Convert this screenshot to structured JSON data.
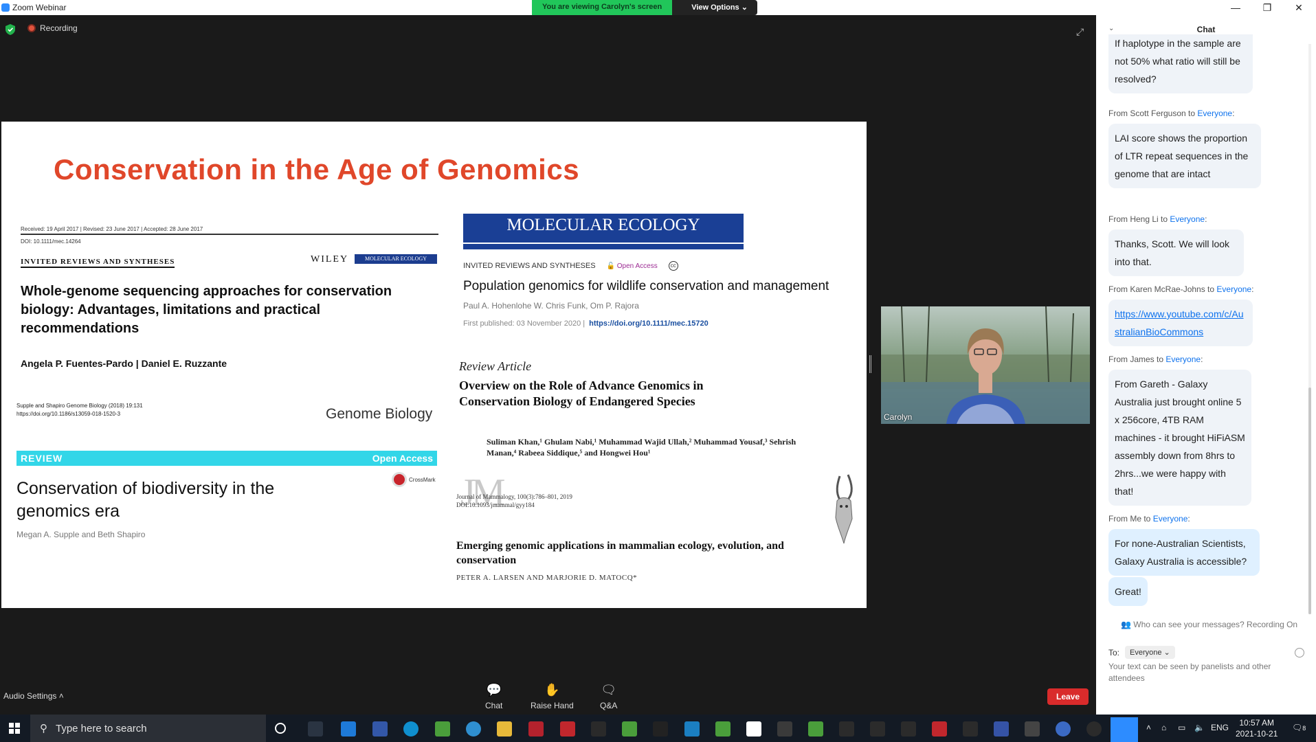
{
  "window": {
    "title": "Zoom Webinar",
    "viewing_message": "You are viewing Carolyn's screen",
    "view_options_label": "View Options"
  },
  "meeting": {
    "recording_label": "Recording",
    "speaker_name": "Carolyn",
    "audio_settings_label": "Audio Settings",
    "controls": [
      {
        "label": "Chat",
        "icon": "chat-icon"
      },
      {
        "label": "Raise Hand",
        "icon": "raise-hand-icon"
      },
      {
        "label": "Q&A",
        "icon": "qa-icon"
      }
    ],
    "leave_label": "Leave"
  },
  "slide": {
    "title": "Conservation in the Age of Genomics",
    "paper1": {
      "meta": "Received: 19 April 2017     |     Revised: 23 June 2017     |     Accepted: 28 June 2017",
      "doi": "DOI: 10.1111/mec.14264",
      "section": "INVITED REVIEWS AND SYNTHESES",
      "publisher": "WILEY",
      "journal_badge": "MOLECULAR ECOLOGY",
      "title": "Whole-genome sequencing approaches for conservation biology: Advantages, limitations and practical recommendations",
      "authors": "Angela P. Fuentes-Pardo   |   Daniel E. Ruzzante"
    },
    "paper2": {
      "cite_line1": "Supple and Shapiro Genome Biology  (2018) 19:131",
      "cite_line2": "https://doi.org/10.1186/s13059-018-1520-3",
      "journal": "Genome Biology",
      "review_label": "REVIEW",
      "open_access_label": "Open Access",
      "crossmark_label": "CrossMark",
      "title": "Conservation of biodiversity in the genomics era",
      "authors": "Megan A. Supple  and Beth Shapiro"
    },
    "paper3": {
      "journal_banner": "MOLECULAR ECOLOGY",
      "section": "INVITED REVIEWS AND SYNTHESES",
      "open_access_label": "Open Access",
      "title": "Population genomics for wildlife conservation and management",
      "authors": "Paul A. Hohenlohe   W. Chris Funk, Om P. Rajora",
      "published": "First published: 03 November 2020  |",
      "doi": "https://doi.org/10.1111/mec.15720"
    },
    "paper4": {
      "kind": "Review Article",
      "title": "Overview on the Role of Advance Genomics in Conservation Biology of Endangered Species",
      "authors": "Suliman Khan,¹ Ghulam Nabi,¹ Muhammad Wajid Ullah,² Muhammad Yousaf,³ Sehrish Manan,⁴ Rabeea Siddique,⁵ and Hongwei Hou¹"
    },
    "paper5": {
      "logo_text": "JM",
      "cite_line1": "Journal of Mammalogy, 100(3):786–801, 2019",
      "cite_line2": "DOI:10.1093/jmammal/gyy184",
      "title": "Emerging genomic applications in mammalian ecology, evolution, and conservation",
      "authors": "PETER A. LARSEN AND MARJORIE D. MATOCQ*"
    }
  },
  "chat": {
    "header": "Chat",
    "messages": [
      {
        "from": "",
        "to": "",
        "text": "If haplotype in the sample are not 50% what ratio will still be resolved?"
      },
      {
        "from": "From Scott Ferguson to ",
        "to": "Everyone",
        "text": "LAI score shows the proportion of LTR repeat sequences in the genome that are intact"
      },
      {
        "from": "From Heng Li to ",
        "to": "Everyone",
        "text": "Thanks, Scott. We will look into that."
      },
      {
        "from": "From Karen McRae-Johns to ",
        "to": "Everyone",
        "text": "https://www.youtube.com/c/AustralianBioCommons"
      },
      {
        "from": "From James to ",
        "to": "Everyone",
        "text": "From Gareth - Galaxy Australia just brought online 5 x 256core, 4TB RAM machines - it brought HiFiASM assembly down from 8hrs to 2hrs...we were happy with that!"
      },
      {
        "from": "From Me to ",
        "to": "Everyone",
        "text": "For none-Australian Scientists, Galaxy Australia is accessible?"
      },
      {
        "from": "",
        "to": "",
        "text": "Great!"
      }
    ],
    "privacy_note": "Who can see your messages? Recording On",
    "to_label": "To:",
    "to_value": "Everyone",
    "input_placeholder": "Your text can be seen by panelists and other attendees"
  },
  "taskbar": {
    "search_placeholder": "Type here to search",
    "language": "ENG",
    "time": "10:57 AM",
    "date": "2021-10-21",
    "notification_count": "8"
  }
}
